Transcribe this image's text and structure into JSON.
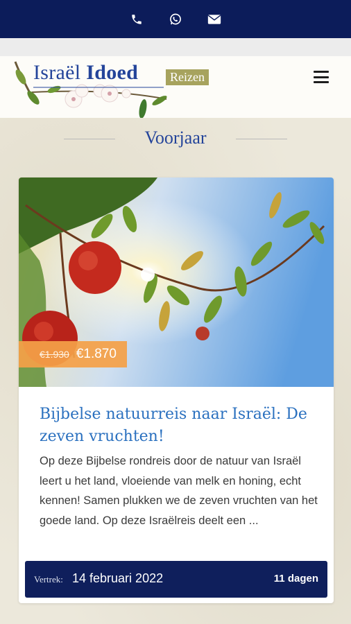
{
  "topbar": {
    "icons": [
      "phone-icon",
      "whatsapp-icon",
      "mail-icon"
    ],
    "background": "#0c1c5a"
  },
  "header": {
    "logo_main": "Israël",
    "logo_bold": "Idoed",
    "logo_badge": "Reizen",
    "menu_icon": "hamburger-menu-icon"
  },
  "section": {
    "title": "Voorjaar"
  },
  "card": {
    "image_description_icon": "pomegranate-photo",
    "price_old": "€1.930",
    "price_new": "€1.870",
    "title": "Bijbelse natuurreis naar Israël: De zeven vruchten!",
    "description": "Op deze Bijbelse rondreis door de natuur van Israël leert u het land, vloeiende van melk en honing, echt kennen! Samen plukken we de zeven vruchten van het goede land. Op deze Israëlreis deelt een ...",
    "departure_label": "Vertrek:",
    "departure_date": "14 februari 2022",
    "duration": "11 dagen"
  },
  "colors": {
    "navy": "#0c1c5a",
    "title_blue": "#24449a",
    "link_blue": "#2a70bf",
    "price_orange": "#f4a048",
    "badge_olive": "#a7a35e"
  }
}
